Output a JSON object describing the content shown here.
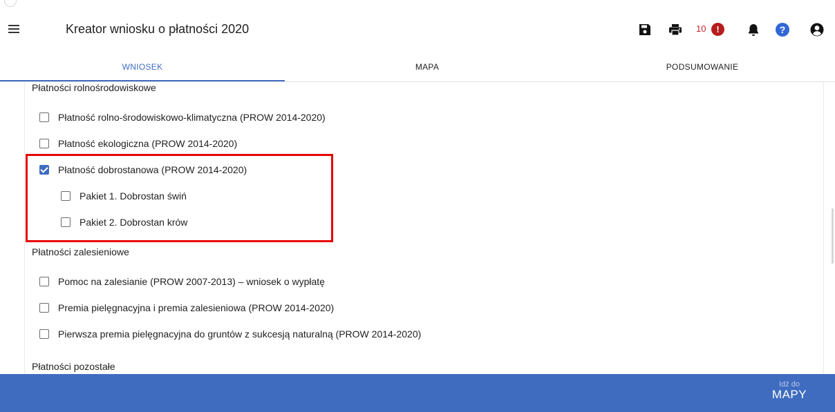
{
  "app": {
    "title": "Kreator wniosku o płatności 2020"
  },
  "toolbar": {
    "icons": [
      "menu-icon",
      "save-icon",
      "print-icon",
      "alert-icon",
      "bell-icon",
      "help-icon",
      "account-icon"
    ],
    "notification_count": "10",
    "alert_symbol": "!"
  },
  "tabs": [
    {
      "label": "WNIOSEK",
      "active": true
    },
    {
      "label": "MAPA",
      "active": false
    },
    {
      "label": "PODSUMOWANIE",
      "active": false
    }
  ],
  "sections": {
    "agri_env": {
      "title": "Płatności rolnośrodowiskowe",
      "items": [
        {
          "label": "Płatność rolno-środowiskowo-klimatyczna (PROW 2014-2020)",
          "checked": false
        },
        {
          "label": "Płatność ekologiczna (PROW 2014-2020)",
          "checked": false
        },
        {
          "label": "Płatność dobrostanowa (PROW 2014-2020)",
          "checked": true
        },
        {
          "label": "Pakiet 1. Dobrostan świń",
          "checked": false
        },
        {
          "label": "Pakiet 2. Dobrostan krów",
          "checked": false
        }
      ]
    },
    "forestry": {
      "title": "Płatności zalesieniowe",
      "items": [
        {
          "label": "Pomoc na zalesianie (PROW 2007-2013) – wniosek o wypłatę",
          "checked": false
        },
        {
          "label": "Premia pielęgnacyjna i premia zalesieniowa (PROW 2014-2020)",
          "checked": false
        },
        {
          "label": "Pierwsza premia pielęgnacyjna do gruntów z sukcesją naturalną (PROW 2014-2020)",
          "checked": false
        }
      ]
    },
    "other": {
      "title": "Płatności pozostałe"
    }
  },
  "footer": {
    "small_label": "Idź do",
    "big_label": "MAPY"
  },
  "colors": {
    "accent": "#3f6cbf",
    "alert": "#b71c1c",
    "highlight": "#e60000",
    "help": "#3367d6"
  }
}
